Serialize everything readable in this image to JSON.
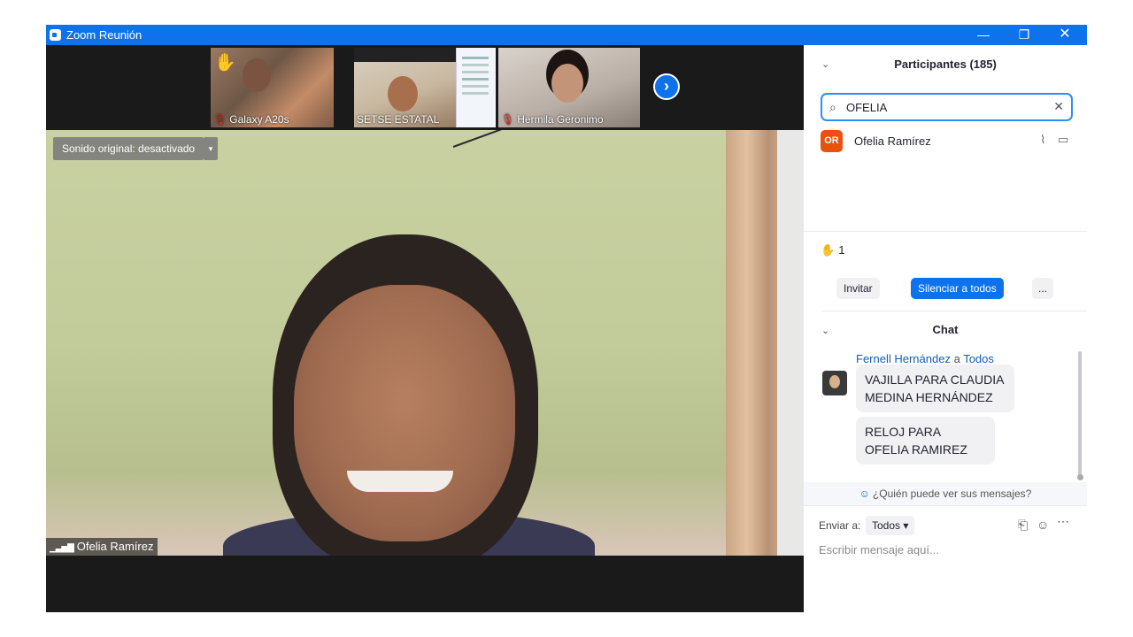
{
  "window": {
    "title": "Zoom Reunión",
    "minimize": "—",
    "maximize": "❐",
    "close": "✕"
  },
  "thumbnails": [
    {
      "name": "Galaxy A20s",
      "muted": true,
      "hand_raised": true
    },
    {
      "name": "SETSE ESTATAL",
      "muted": false
    },
    {
      "name": "Hermila Geronimo",
      "muted": true
    }
  ],
  "icons": {
    "next": "›",
    "hand": "✋",
    "mute": "∕",
    "search": "⌕",
    "clear": "✕",
    "mic": "⌇",
    "cam": "▭",
    "chevron": "⌄",
    "signal": "▁▃▅▇",
    "file": "⎗",
    "emoji": "☺",
    "more": "⋯",
    "dropdown": "▾",
    "person": "☺"
  },
  "main_video": {
    "sound_button": "Sonido original: desactivado",
    "participant_label": "Ofelia Ramírez"
  },
  "participants_panel": {
    "title": "Participantes (185)",
    "search_value": "OFELIA",
    "results": [
      {
        "initials": "OR",
        "name": "Ofelia Ramírez",
        "avatar_color": "#e8520c"
      }
    ],
    "raised_hands": "1",
    "invite": "Invitar",
    "mute_all": "Silenciar a todos",
    "more": "..."
  },
  "chat": {
    "title": "Chat",
    "sender": "Fernell Hernández",
    "to_word": "a",
    "recipient": "Todos",
    "messages": [
      "VAJILLA PARA CLAUDIA MEDINA HERNÁNDEZ",
      "RELOJ PARA  OFELIA RAMIREZ"
    ],
    "who_can_see": "¿Quién puede ver sus mensajes?",
    "send_to_label": "Enviar a:",
    "send_to_value": "Todos",
    "input_placeholder": "Escribir mensaje aquí..."
  },
  "colors": {
    "accent": "#0e72ed",
    "avatar": "#e8520c"
  }
}
